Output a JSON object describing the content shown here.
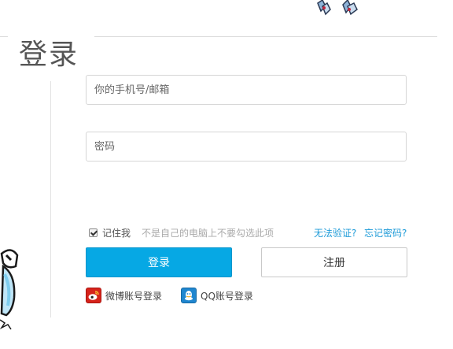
{
  "page": {
    "title": "登录"
  },
  "form": {
    "phone_placeholder": "你的手机号/邮箱",
    "password_placeholder": "密码",
    "remember_label": "记住我",
    "remember_checked": true,
    "remember_hint": "不是自己的电脑上不要勾选此项",
    "cannot_verify_link": "无法验证?",
    "forgot_password_link": "忘记密码?",
    "login_button": "登录",
    "register_button": "注册"
  },
  "social_login": {
    "weibo_label": "微博账号登录",
    "qq_label": "QQ账号登录"
  },
  "colors": {
    "primary_button": "#06a8e4",
    "link": "#1e9bd8",
    "weibo": "#d6231b",
    "qq": "#1f86cf"
  },
  "icons": {
    "weibo": "weibo-icon",
    "qq": "qq-icon",
    "checkbox": "checkbox-checked-icon"
  }
}
